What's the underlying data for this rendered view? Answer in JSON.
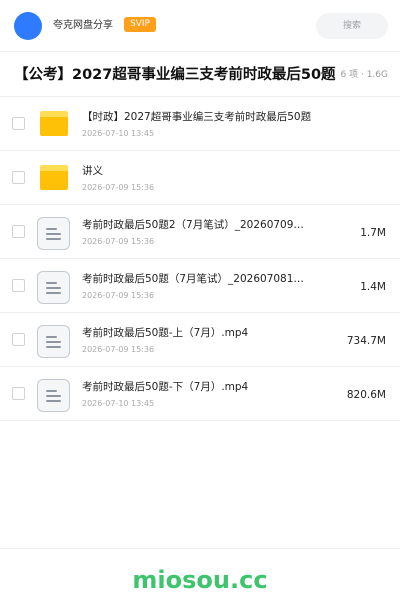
{
  "header": {
    "owner_name": "夸克网盘分享",
    "badge": "SVIP",
    "search_label": "搜索"
  },
  "share": {
    "title": "【公考】2027超哥事业编三支考前时政最后50题",
    "meta": "共 6 项 · 1.6G"
  },
  "files": [
    {
      "type": "folder",
      "name": "【时政】2027超哥事业编三支考前时政最后50题",
      "date": "2026-07-10 13:45",
      "size": ""
    },
    {
      "type": "folder",
      "name": "讲义",
      "date": "2026-07-09 15:36",
      "size": ""
    },
    {
      "type": "file",
      "name": "考前时政最后50题2（7月笔试）_20260709…",
      "date": "2026-07-09 15:36",
      "size": "1.7M"
    },
    {
      "type": "file",
      "name": "考前时政最后50题（7月笔试）_202607081…",
      "date": "2026-07-09 15:36",
      "size": "1.4M"
    },
    {
      "type": "file",
      "name": "考前时政最后50题-上（7月）.mp4",
      "date": "2026-07-09 15:36",
      "size": "734.7M"
    },
    {
      "type": "file",
      "name": "考前时政最后50题-下（7月）.mp4",
      "date": "2026-07-10 13:45",
      "size": "820.6M"
    }
  ],
  "watermark": "miosou.cc",
  "colors": {
    "avatar": "#2f7bff",
    "badge": "#ff9f1a",
    "folder": "#ffc107",
    "watermark": "#3ec46d"
  }
}
